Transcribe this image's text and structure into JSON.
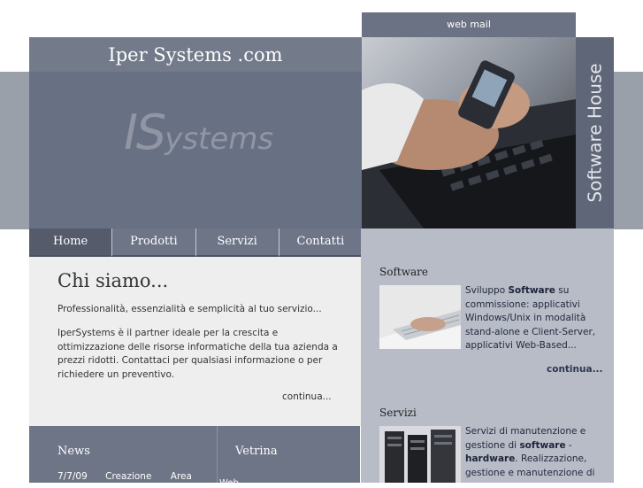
{
  "header": {
    "site_title": "Iper Systems .com",
    "logo_big": "IS",
    "logo_rest": "ystems",
    "webmail": "web mail",
    "side_text": "Software House"
  },
  "nav": [
    "Home",
    "Prodotti",
    "Servizi",
    "Contatti"
  ],
  "main": {
    "heading": "Chi siamo...",
    "intro": "Professionalità, essenzialità e semplicità al tuo servizio...",
    "body": "IperSystems è il partner ideale per la crescita e ottimizzazione delle risorse informatiche della tua azienda a prezzi ridotti. Contattaci per qualsiasi informazione o per richiedere un preventivo.",
    "more": "continua..."
  },
  "news": {
    "heading": "News",
    "item_date": "7/7/09",
    "item_word1": "Creazione",
    "item_word2": "Area"
  },
  "vetrina": {
    "heading": "Vetrina",
    "cut_text": "Web..."
  },
  "software": {
    "heading": "Software",
    "pre": "Sviluppo ",
    "bold": "Software",
    "post": " su commissione: applicativi Windows/Unix in modalità stand-alone e Client-Server, applicativi Web-Based...",
    "more": "continua..."
  },
  "servizi": {
    "heading": "Servizi",
    "pre": "Servizi di manutenzione e gestione di ",
    "bold1": "software",
    "mid": " - ",
    "bold2": "hardware",
    "post": ". Realizzazione, gestione e manutenzione di"
  },
  "colors": {
    "header_bg": "#687083",
    "band": "#9aa0aa",
    "right_panel": "#b7bcc7",
    "content_bg": "#eeeeee"
  }
}
